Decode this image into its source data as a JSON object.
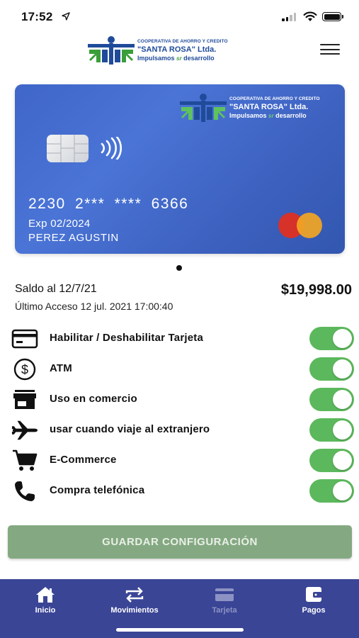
{
  "status_bar": {
    "time": "17:52"
  },
  "brand": {
    "line1": "COOPERATIVA DE AHORRO Y CREDITO",
    "line2": "\"SANTA ROSA\" Ltda.",
    "line3_a": "Impulsamos",
    "line3_b": "desarrollo"
  },
  "card": {
    "number": "2230 2*** **** 6366",
    "expiry": "Exp 02/2024",
    "holder": "PEREZ AGUSTIN",
    "network_icon": "mastercard-logo"
  },
  "balance": {
    "label": "Saldo al 12/7/21",
    "amount": "$19,998.00",
    "last_access": "Último Acceso  12 jul. 2021 17:00:40"
  },
  "settings": [
    {
      "label": "Habilitar / Deshabilitar Tarjeta",
      "icon": "credit-card-icon",
      "enabled": true
    },
    {
      "label": "ATM",
      "icon": "dollar-circle-icon",
      "enabled": true
    },
    {
      "label": "Uso en comercio",
      "icon": "store-icon",
      "enabled": true
    },
    {
      "label": "usar cuando viaje al extranjero",
      "icon": "airplane-icon",
      "enabled": true
    },
    {
      "label": "E-Commerce",
      "icon": "shopping-cart-icon",
      "enabled": true
    },
    {
      "label": "Compra telefónica",
      "icon": "phone-icon",
      "enabled": true
    }
  ],
  "save_button": {
    "label": "GUARDAR CONFIGURACIÓN"
  },
  "nav": {
    "items": [
      {
        "label": "Inicio",
        "icon": "home-icon"
      },
      {
        "label": "Movimientos",
        "icon": "transfer-icon"
      },
      {
        "label": "Tarjeta",
        "icon": "card-icon",
        "active": true
      },
      {
        "label": "Pagos",
        "icon": "wallet-icon"
      }
    ]
  },
  "colors": {
    "toggle_on": "#5cb85c",
    "save_button": "#84a982",
    "nav_bg": "#3b4596",
    "card_blue": "#4a74d6",
    "brand_blue": "#1f4b9a",
    "brand_green": "#3a9e3a"
  }
}
